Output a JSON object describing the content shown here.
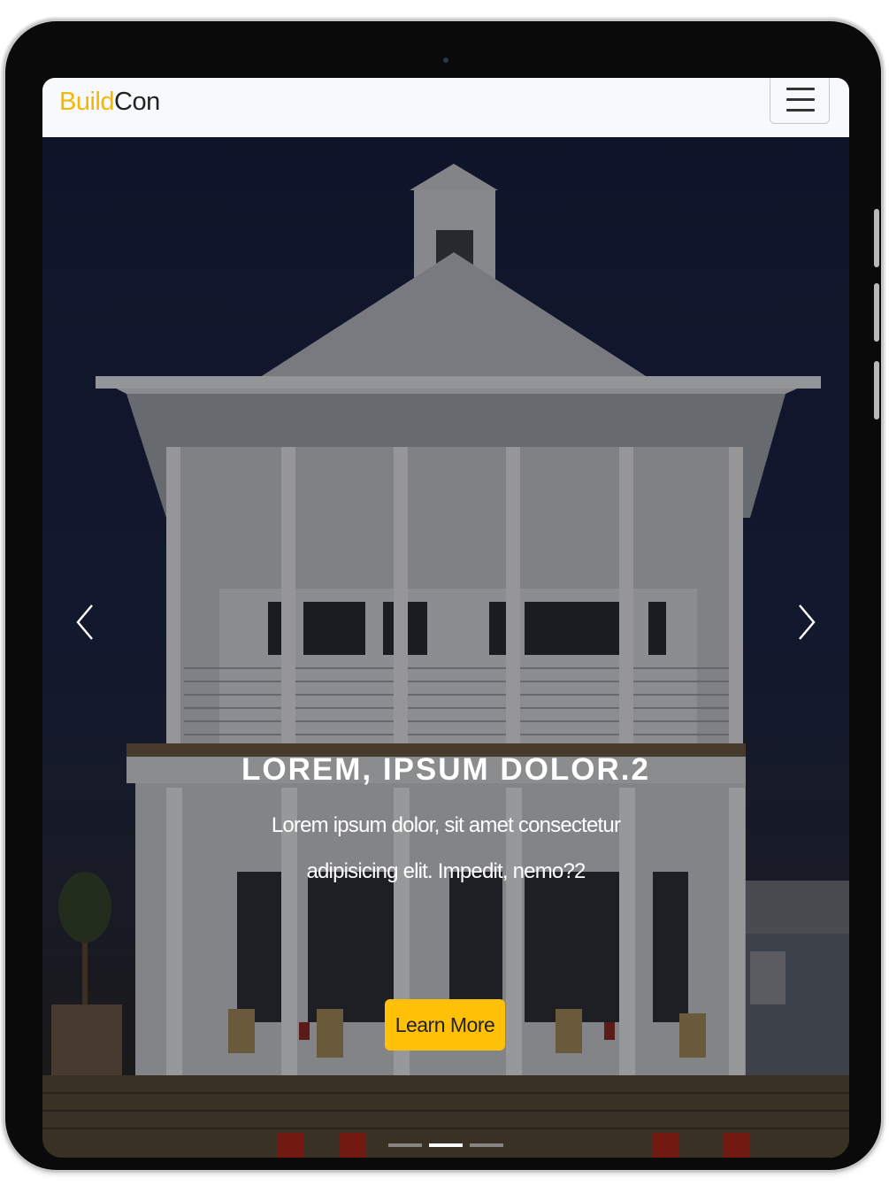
{
  "navbar": {
    "brand_accent": "Build",
    "brand_rest": "Con",
    "menu_icon": "hamburger-icon"
  },
  "carousel": {
    "prev_icon": "chevron-left-icon",
    "next_icon": "chevron-right-icon",
    "active_slide": 2,
    "slide_count": 3,
    "caption": {
      "title": "LOREM, IPSUM DOLOR.2",
      "text": "Lorem ipsum dolor, sit amet consectetur adipisicing elit. Impedit, nemo?2",
      "button_label": "Learn More"
    }
  },
  "colors": {
    "accent": "#f5b800",
    "button": "#ffc107",
    "navbar_bg": "#f8f9fa"
  }
}
